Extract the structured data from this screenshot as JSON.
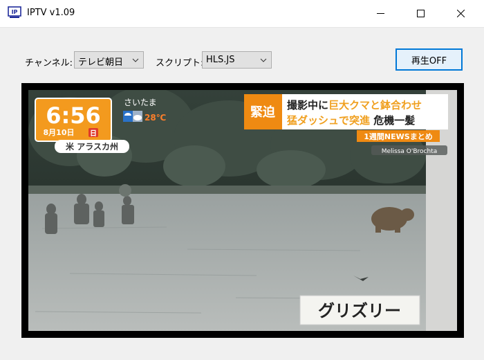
{
  "window": {
    "title": "IPTV v1.09",
    "icon_text": "IP"
  },
  "controls": {
    "channel_label": "チャンネル:",
    "channel_value": "テレビ朝日",
    "script_label": "スクリプト:",
    "script_value": "HLS.JS",
    "play_button": "再生OFF"
  },
  "video": {
    "time": "6:56",
    "date": "8月10日",
    "weekday": "日",
    "weather_city": "さいたま",
    "temperature": "28℃",
    "location": "米 アラスカ州",
    "breaking": "緊迫",
    "headline_line1_a": "撮影中に",
    "headline_line1_b": "巨大クマと鉢合わせ",
    "headline_line2_a": "猛ダッシュで突進",
    "headline_line2_b": " 危機一髪",
    "news_tag": "1週間NEWSまとめ",
    "credit": "Melissa O'Brochta",
    "caption": "グリズリー"
  },
  "colors": {
    "accent": "#0078d7",
    "clock_orange": "#f39a1e",
    "headline_orange": "#f0a020",
    "breaking_orange": "#ef8a12"
  }
}
